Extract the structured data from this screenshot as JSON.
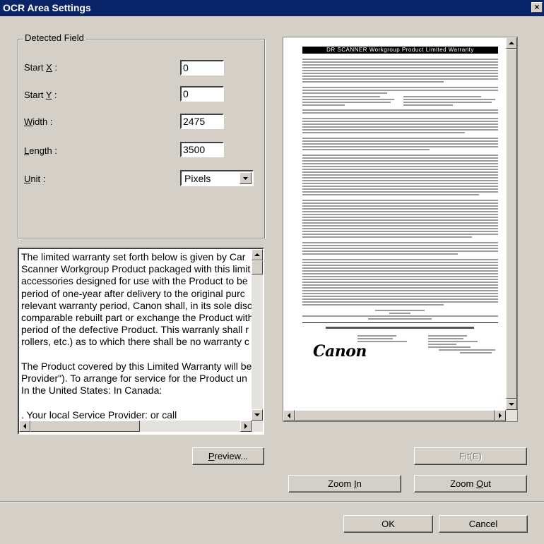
{
  "window": {
    "title": "OCR Area Settings",
    "close_glyph": "×"
  },
  "detected_field": {
    "group_label": "Detected Field",
    "start_x": {
      "pre": "Start ",
      "ul": "X",
      "post": " :",
      "value": "0"
    },
    "start_y": {
      "pre": "Start ",
      "ul": "Y",
      "post": " :",
      "value": "0"
    },
    "width": {
      "ul": "W",
      "post": "idth :",
      "value": "2475"
    },
    "length": {
      "ul": "L",
      "post": "ength :",
      "value": "3500"
    },
    "unit": {
      "ul": "U",
      "post": "nit :",
      "value": "Pixels"
    }
  },
  "text_area": {
    "content": "The limited warranty set forth below is given by Car\nScanner Workgroup Product packaged with this limit\naccessories designed for use with the Product to be\nperiod of one-year after delivery to the original purc\nrelevant warranty period, Canon shall, in its sole disc\ncomparable rebuilt part or exchange the Product with\nperiod of the defective Product. This warranly shall r\nrollers, etc.) as to which there shall be no warranty c\n\nThe Product covered by this Limited Warranty will be\nProvider\"). To arrange for service for the Product un\nIn the United States: In Canada:\n\n. Your local Service Provider: or call"
  },
  "preview_doc": {
    "title": "DR SCANNER Workgroup Product Limited Warranty",
    "brand": "Canon"
  },
  "buttons": {
    "preview": {
      "ul": "P",
      "post": "review..."
    },
    "fit": "Fit(E)",
    "zoom_in": {
      "pre": "Zoom ",
      "ul": "I",
      "post": "n"
    },
    "zoom_out": {
      "pre": "Zoom ",
      "ul": "O",
      "post": "ut"
    },
    "ok": "OK",
    "cancel": "Cancel"
  }
}
